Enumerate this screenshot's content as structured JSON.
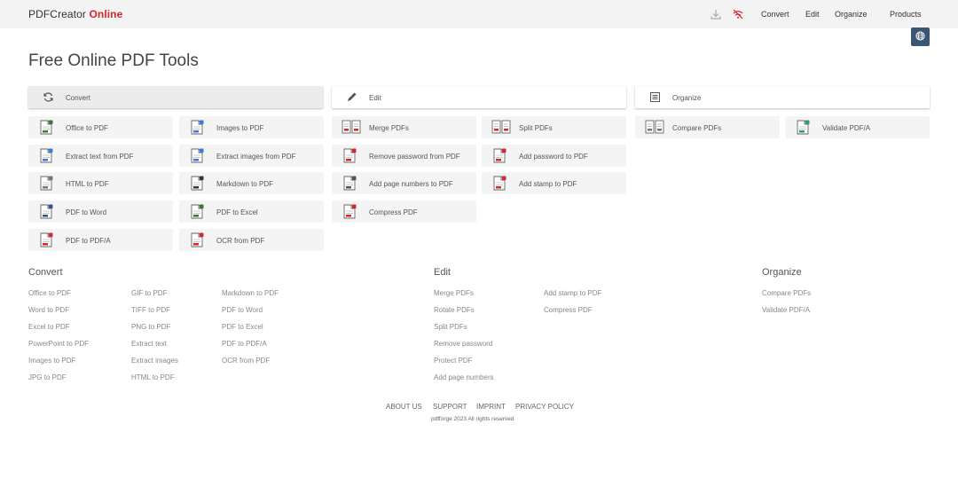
{
  "header": {
    "logo_main": "PDFCreator",
    "logo_accent": "Online",
    "nav": [
      "Convert",
      "Edit",
      "Organize",
      "Products"
    ]
  },
  "page_title": "Free Online PDF Tools",
  "categories": [
    {
      "label": "Convert",
      "icon": "refresh-icon"
    },
    {
      "label": "Edit",
      "icon": "pencil-icon"
    },
    {
      "label": "Organize",
      "icon": "list-icon"
    }
  ],
  "tools": {
    "convert_a": [
      "Office to PDF",
      "Extract text from PDF",
      "HTML to PDF",
      "PDF to Word",
      "PDF to PDF/A"
    ],
    "convert_b": [
      "Images to PDF",
      "Extract images from PDF",
      "Markdown to PDF",
      "PDF to Excel",
      "OCR from PDF"
    ],
    "edit_a": [
      "Merge PDFs",
      "Remove password from PDF",
      "Add page numbers to PDF",
      "Compress PDF"
    ],
    "edit_b": [
      "Split PDFs",
      "Add password to PDF",
      "Add stamp to PDF"
    ],
    "organize_a": [
      "Compare PDFs"
    ],
    "organize_b": [
      "Validate PDF/A"
    ]
  },
  "tool_icons": {
    "convert_a": [
      "office-doc-icon",
      "text-extract-icon",
      "html-doc-icon",
      "word-doc-icon",
      "pdfa-doc-icon"
    ],
    "convert_b": [
      "image-doc-icon",
      "image-extract-icon",
      "markdown-doc-icon",
      "excel-doc-icon",
      "ocr-doc-icon"
    ],
    "edit_a": [
      "merge-icon",
      "unlock-doc-icon",
      "page-number-icon",
      "compress-doc-icon"
    ],
    "edit_b": [
      "split-icon",
      "lock-doc-icon",
      "stamp-doc-icon"
    ],
    "organize_a": [
      "compare-icon"
    ],
    "organize_b": [
      "validate-icon"
    ]
  },
  "footer": {
    "convert": {
      "title": "Convert",
      "col1": [
        "Office to PDF",
        "Word to PDF",
        "Excel to PDF",
        "PowerPoint to PDF",
        "Images to PDF",
        "JPG to PDF"
      ],
      "col2": [
        "GIF to PDF",
        "TIFF to PDF",
        "PNG to PDF",
        "Extract text",
        "Extract images",
        "HTML to PDF"
      ],
      "col3": [
        "Markdown to PDF",
        "PDF to Word",
        "PDF to Excel",
        "PDF to PDF/A",
        "OCR from PDF"
      ]
    },
    "edit": {
      "title": "Edit",
      "col1": [
        "Merge PDFs",
        "Rotate PDFs",
        "Split PDFs",
        "Remove password",
        "Protect PDF",
        "Add page numbers"
      ],
      "col2": [
        "Add stamp to PDF",
        "Compress PDF"
      ]
    },
    "organize": {
      "title": "Organize",
      "col1": [
        "Compare PDFs",
        "Validate PDF/A"
      ]
    },
    "bottom_links": [
      "ABOUT US",
      "SUPPORT",
      "IMPRINT",
      "PRIVACY POLICY"
    ],
    "copyright": "pdfforge 2023 All rights reserved"
  },
  "colors": {
    "accent": "#d6262e",
    "globe_button": "#3b5673",
    "tile_bg": "#f4f4f4"
  }
}
